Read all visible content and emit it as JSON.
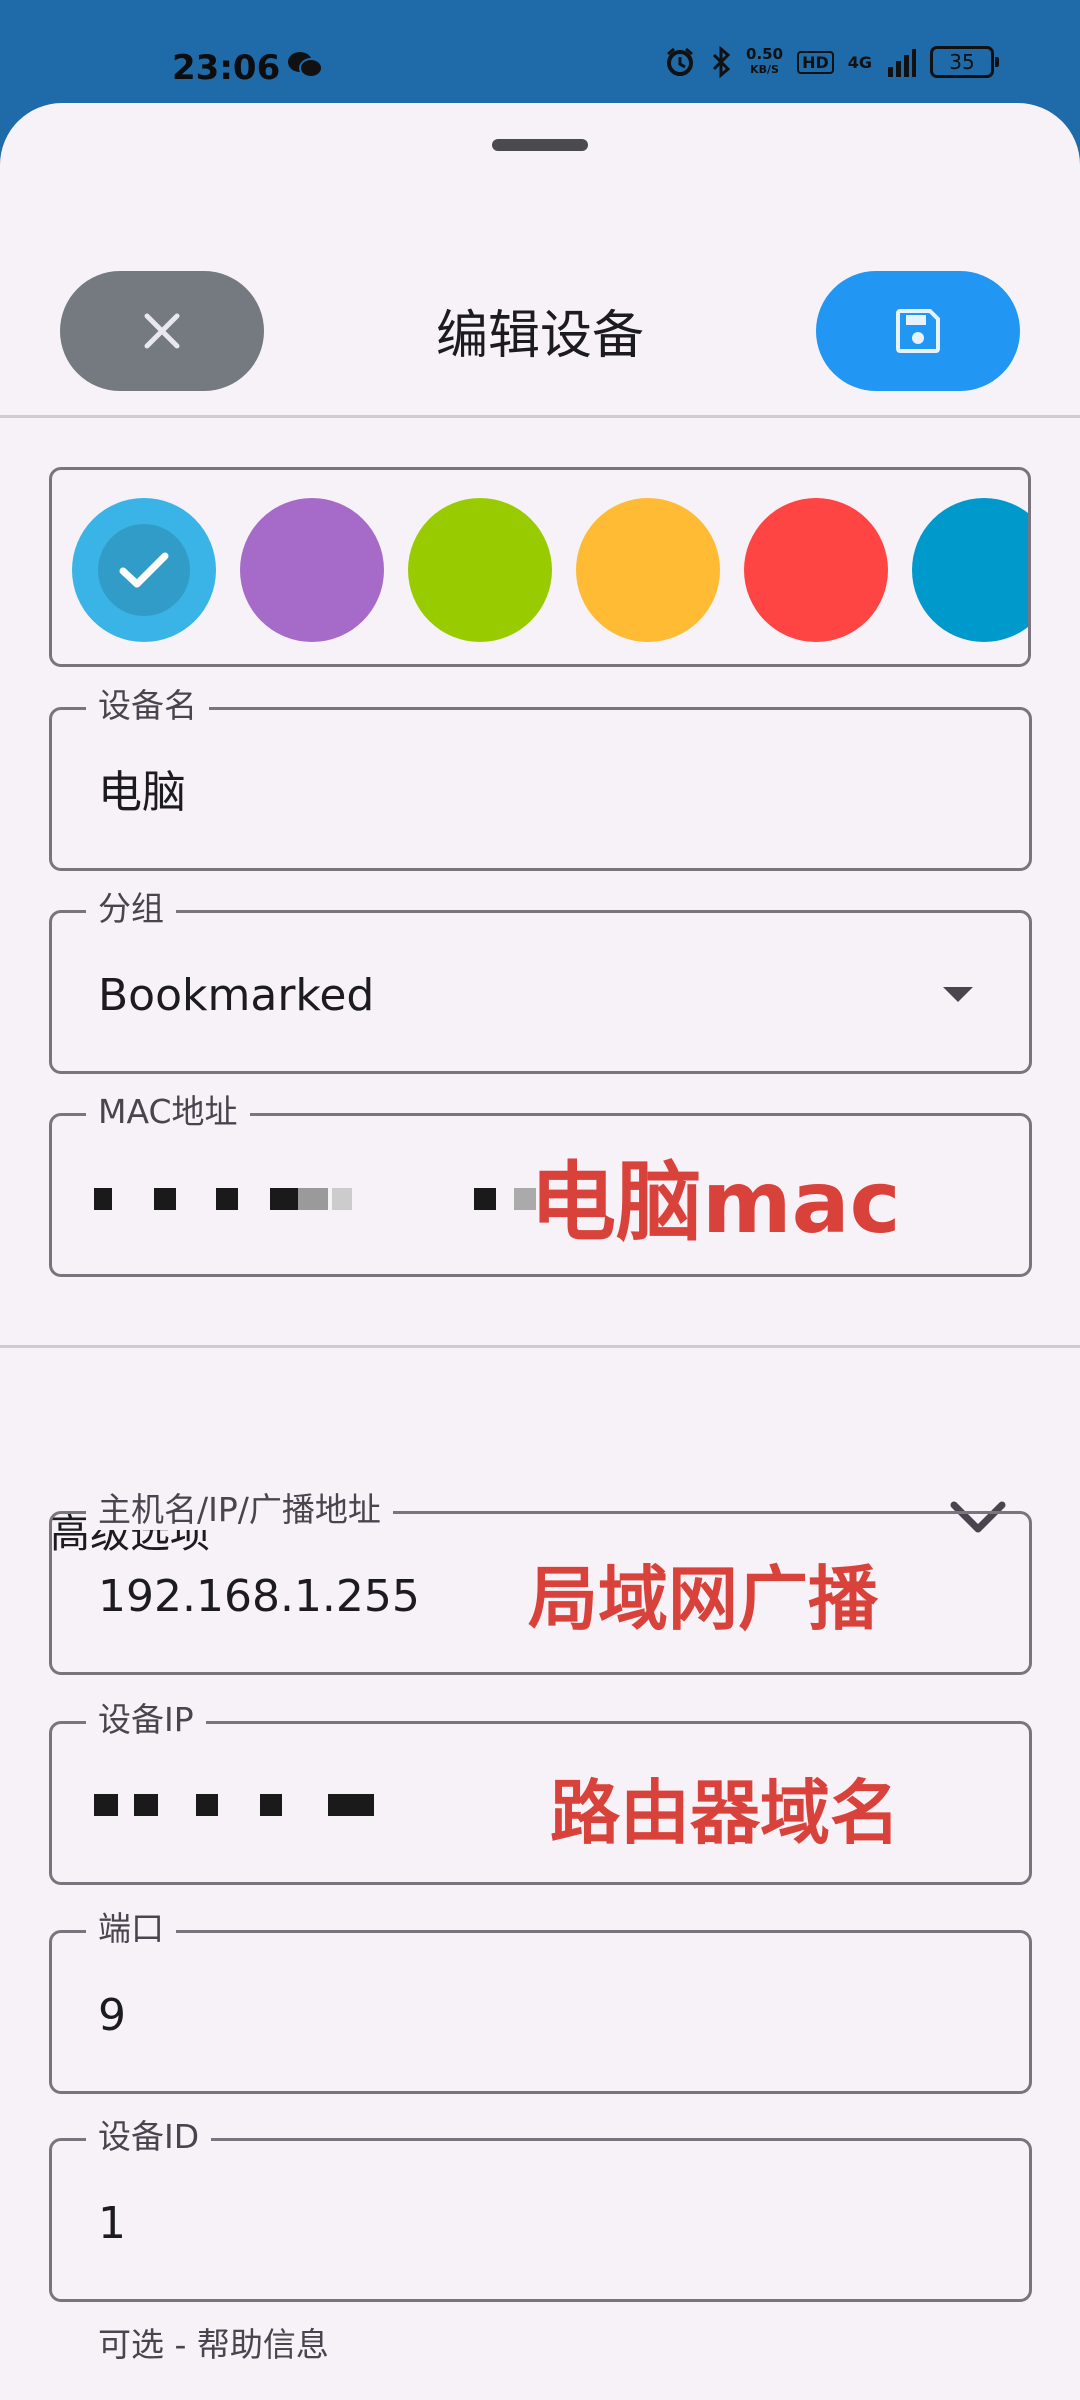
{
  "status_bar": {
    "time": "23:06",
    "speed_value": "0.50",
    "speed_unit": "KB/S",
    "hd": "HD",
    "network": "4G",
    "battery": "35"
  },
  "header": {
    "title": "编辑设备",
    "close_icon": "close-icon",
    "save_icon": "save-icon"
  },
  "colors": {
    "selected": "#3ab4e6",
    "swatches": [
      "#3ab4e6",
      "#a66bc8",
      "#99cc00",
      "#ffbb33",
      "#ff4444",
      "#0099cc"
    ]
  },
  "form": {
    "name": {
      "label": "设备名",
      "value": "电脑"
    },
    "group": {
      "label": "分组",
      "value": "Bookmarked"
    },
    "mac": {
      "label": "MAC地址",
      "annotation": "电脑mac"
    }
  },
  "advanced": {
    "label": "高级选项",
    "host": {
      "label": "主机名/IP/广播地址",
      "value": "192.168.1.255",
      "annotation": "局域网广播"
    },
    "device_ip": {
      "label": "设备IP",
      "annotation": "路由器域名"
    },
    "port": {
      "label": "端口",
      "value": "9"
    },
    "device_id": {
      "label": "设备ID",
      "value": "1",
      "helper": "可选 - 帮助信息"
    }
  }
}
